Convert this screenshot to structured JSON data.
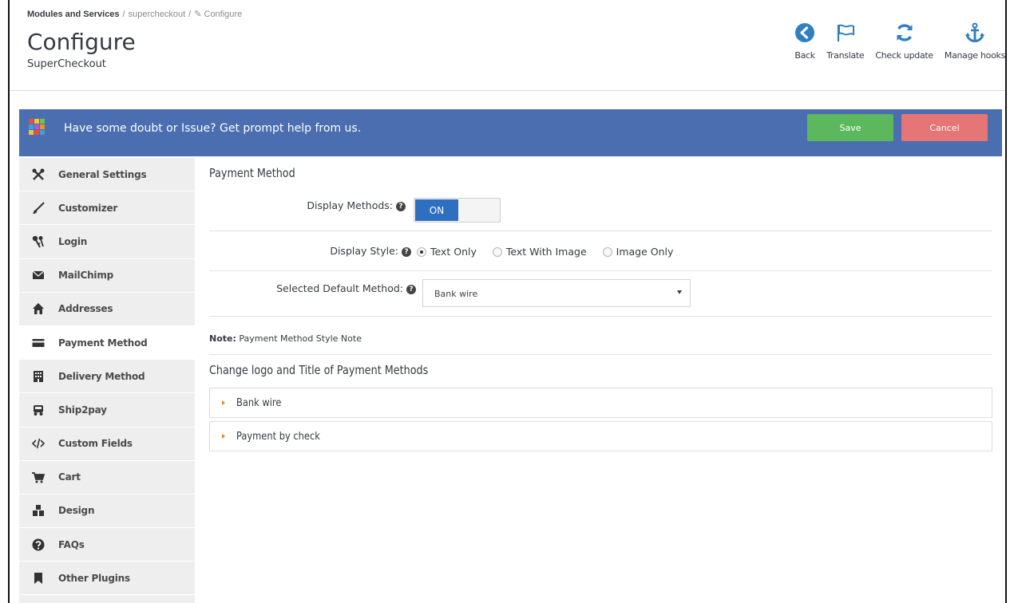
{
  "breadcrumb": {
    "root": "Modules and Services",
    "middle": "supercheckout",
    "current": "Configure",
    "separator": "/"
  },
  "header": {
    "title": "Configure",
    "subtitle": "SuperCheckout"
  },
  "toolbar": {
    "back": "Back",
    "translate": "Translate",
    "check_update": "Check update",
    "manage_hooks": "Manage hooks"
  },
  "banner": {
    "text": "Have some doubt or Issue? Get prompt help from us.",
    "save": "Save",
    "cancel": "Cancel"
  },
  "sidebar": {
    "items": [
      {
        "label": "General Settings",
        "icon": "tools-icon"
      },
      {
        "label": "Customizer",
        "icon": "brush-icon"
      },
      {
        "label": "Login",
        "icon": "keys-icon"
      },
      {
        "label": "MailChimp",
        "icon": "envelope-icon"
      },
      {
        "label": "Addresses",
        "icon": "home-icon"
      },
      {
        "label": "Payment Method",
        "icon": "credit-card-icon"
      },
      {
        "label": "Delivery Method",
        "icon": "building-icon"
      },
      {
        "label": "Ship2pay",
        "icon": "truck-icon"
      },
      {
        "label": "Custom Fields",
        "icon": "code-icon"
      },
      {
        "label": "Cart",
        "icon": "cart-icon"
      },
      {
        "label": "Design",
        "icon": "cubes-icon"
      },
      {
        "label": "FAQs",
        "icon": "question-circle-icon"
      },
      {
        "label": "Other Plugins",
        "icon": "bookmark-icon"
      }
    ],
    "active_index": 5
  },
  "main": {
    "section_title": "Payment Method",
    "display_methods": {
      "label": "Display Methods:",
      "toggle_value": "ON"
    },
    "display_style": {
      "label": "Display Style:",
      "options": [
        "Text Only",
        "Text With Image",
        "Image Only"
      ],
      "selected": "Text Only"
    },
    "default_method": {
      "label": "Selected Default Method:",
      "value": "Bank wire"
    },
    "note": {
      "bold": "Note:",
      "text": "Payment Method Style Note"
    },
    "logo_section_title": "Change logo and Title of Payment Methods",
    "accordions": [
      "Bank wire",
      "Payment by check"
    ]
  },
  "colors": {
    "banner": "#4a6eb0",
    "save": "#5cb85c",
    "cancel": "#e67575",
    "toolbar_icon": "#2f7fc1",
    "toggle_on": "#2f6fbf",
    "accordion_arrow": "#e08a1f"
  }
}
